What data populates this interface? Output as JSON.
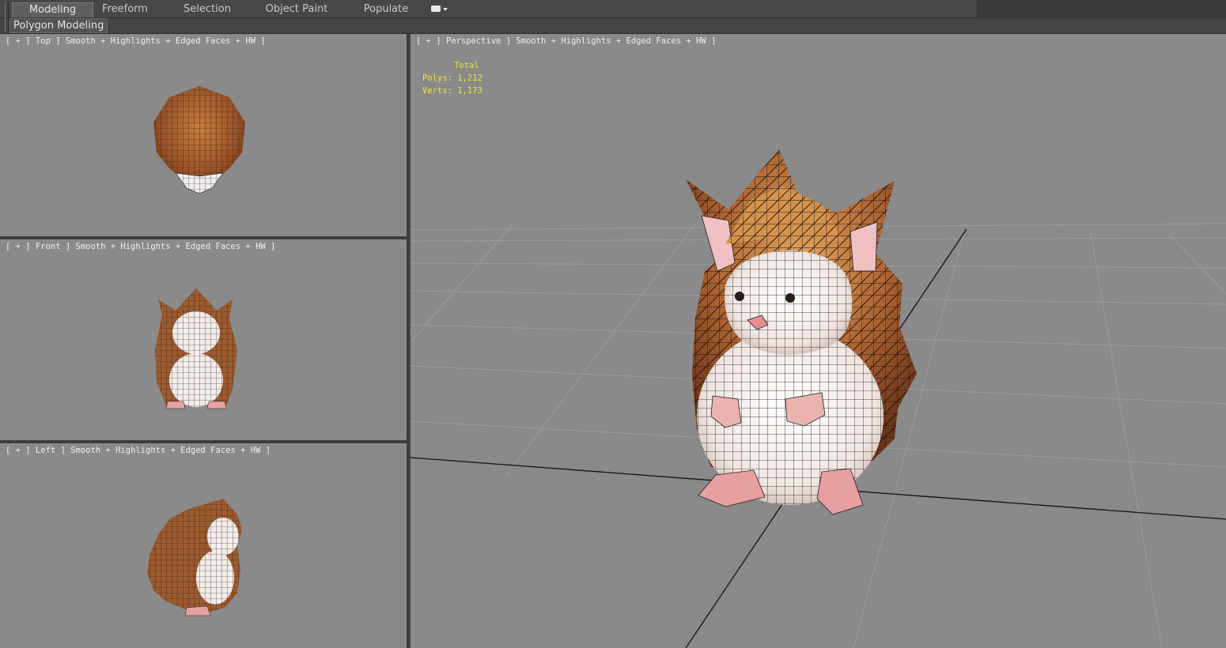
{
  "tabs": [
    {
      "label": "Modeling",
      "active": true
    },
    {
      "label": "Freeform",
      "active": false
    },
    {
      "label": "Selection",
      "active": false
    },
    {
      "label": "Object Paint",
      "active": false
    },
    {
      "label": "Populate",
      "active": false
    }
  ],
  "ribbon_panel": {
    "label": "Polygon Modeling"
  },
  "viewports": {
    "top": {
      "label": "[ + ] Top ] Smooth + Highlights + Edged Faces + HW ]"
    },
    "front": {
      "label": "[ + ] Front ] Smooth + Highlights + Edged Faces + HW ]"
    },
    "left": {
      "label": "[ + ] Left ] Smooth + Highlights + Edged Faces + HW ]"
    },
    "perspective": {
      "label": "[ + ] Perspective ] Smooth + Highlights + Edged Faces + HW ]",
      "stats": {
        "total_label": "Total",
        "polys": "Polys: 1,212",
        "verts": "Verts: 1,173"
      }
    }
  },
  "colors": {
    "viewport_bg": "#8a8a8a",
    "stats_text": "#e8e83a",
    "fur": "#a05a2c",
    "belly": "#f3ece8",
    "skin": "#e8a1a0"
  }
}
